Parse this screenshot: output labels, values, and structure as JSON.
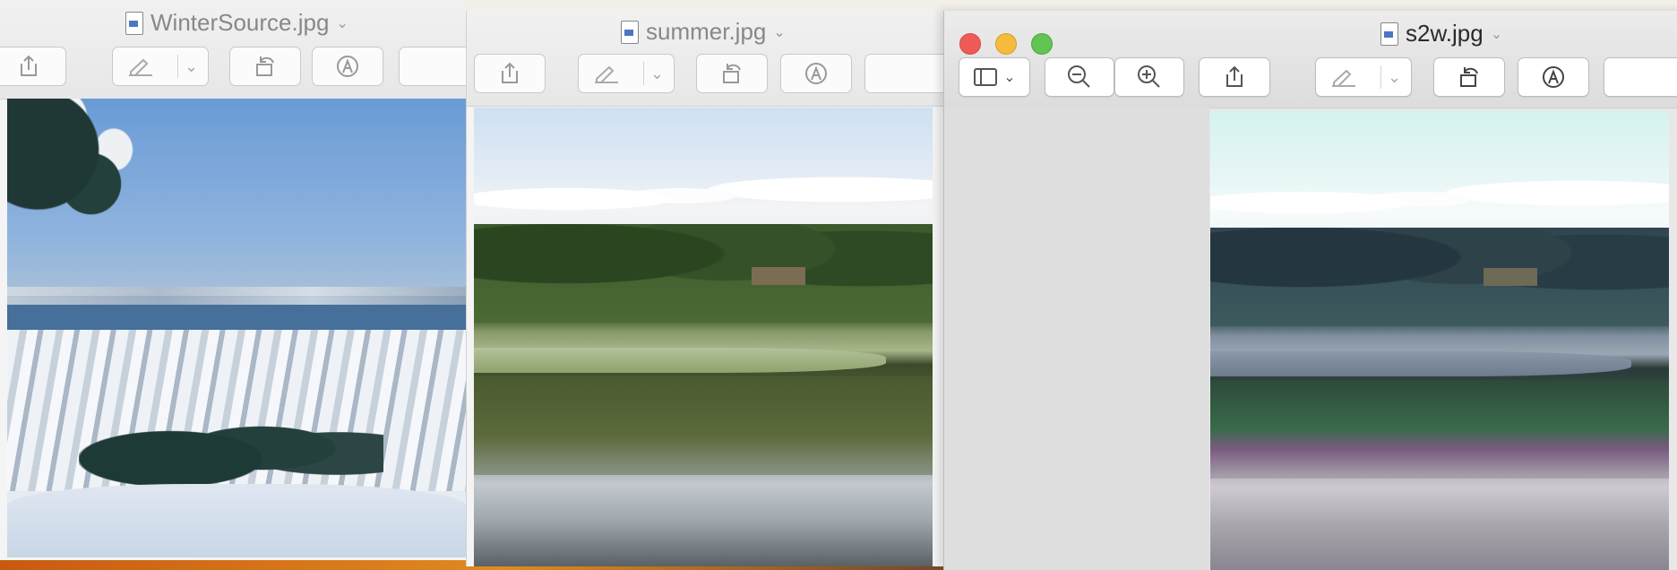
{
  "windows": {
    "winter": {
      "title": "WinterSource.jpg"
    },
    "summer": {
      "title": "summer.jpg"
    },
    "s2w": {
      "title": "s2w.jpg"
    }
  },
  "colors": {
    "close": "#ee5b56",
    "minimize": "#f4bb3c",
    "zoom": "#62c454",
    "sidebar_panel": "#dedede"
  },
  "toolbar_icons": [
    "sidebar-icon",
    "zoom-out-icon",
    "zoom-in-icon",
    "share-icon",
    "markup-pen-icon",
    "rotate-icon",
    "annotate-icon"
  ]
}
